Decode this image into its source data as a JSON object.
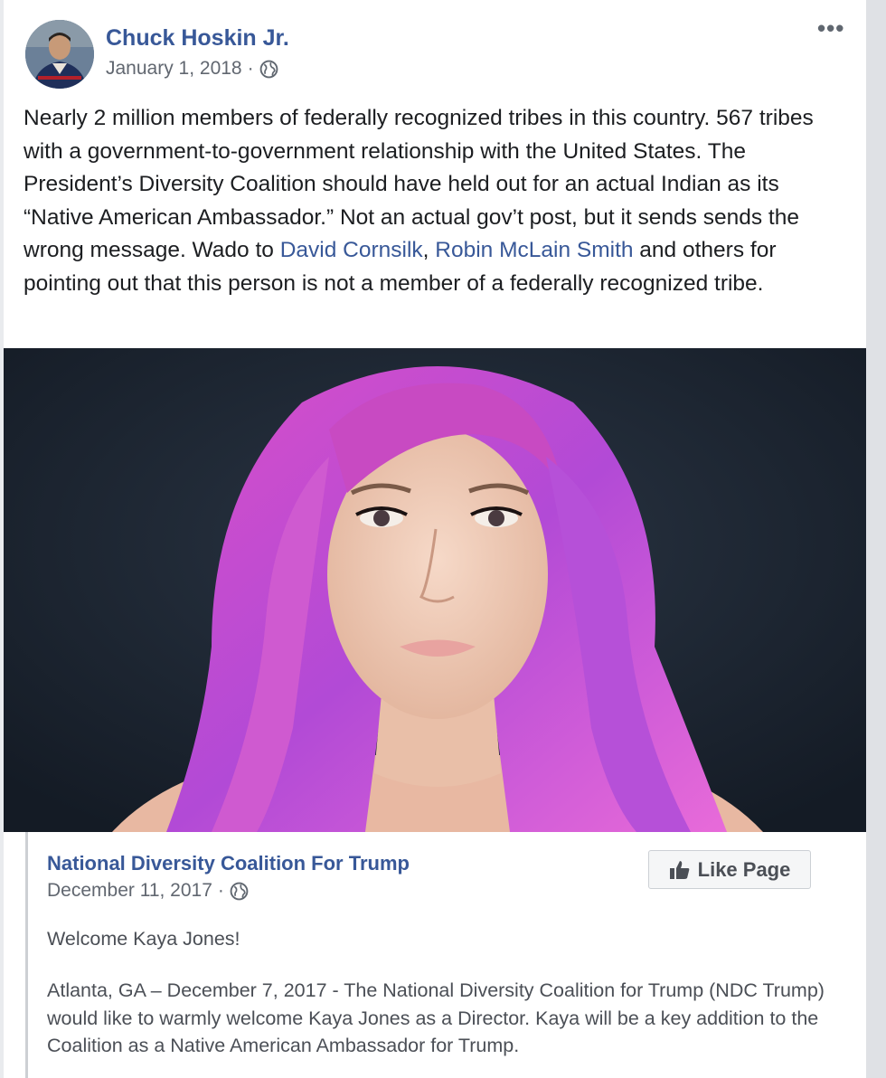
{
  "post": {
    "author": "Chuck Hoskin Jr.",
    "date": "January 1, 2018",
    "separator": "·",
    "more_label": "•••",
    "text_1": "Nearly 2 million members of federally recognized tribes in this country. 567 tribes with a government-to-government relationship with the United States. The President’s Diversity Coalition should have held out for an actual Indian as its “Native American Ambassador.” Not an actual gov’t post, but it sends sends the wrong message. Wado to ",
    "link_1": "David Cornsilk",
    "text_2": ", ",
    "link_2": "Robin McLain Smith",
    "text_3": " and others for pointing out that this person is not a member of a federally recognized tribe."
  },
  "shared": {
    "page_name": "National Diversity Coalition For Trump",
    "date": "December 11, 2017",
    "separator": "·",
    "like_label": "Like Page",
    "welcome": "Welcome Kaya Jones!",
    "body": "Atlanta, GA – December 7, 2017 - The National Diversity Coalition for Trump (NDC Trump) would like to warmly welcome Kaya Jones as a Director. Kaya will be a key addition to the Coalition as a Native American Ambassador for Trump."
  },
  "colors": {
    "link": "#385898",
    "photo_background": "#1e2733",
    "hair": "#c03fb5"
  },
  "icons": {
    "privacy": "globe-icon",
    "like": "thumbs-up-icon",
    "menu": "more-options-icon"
  }
}
